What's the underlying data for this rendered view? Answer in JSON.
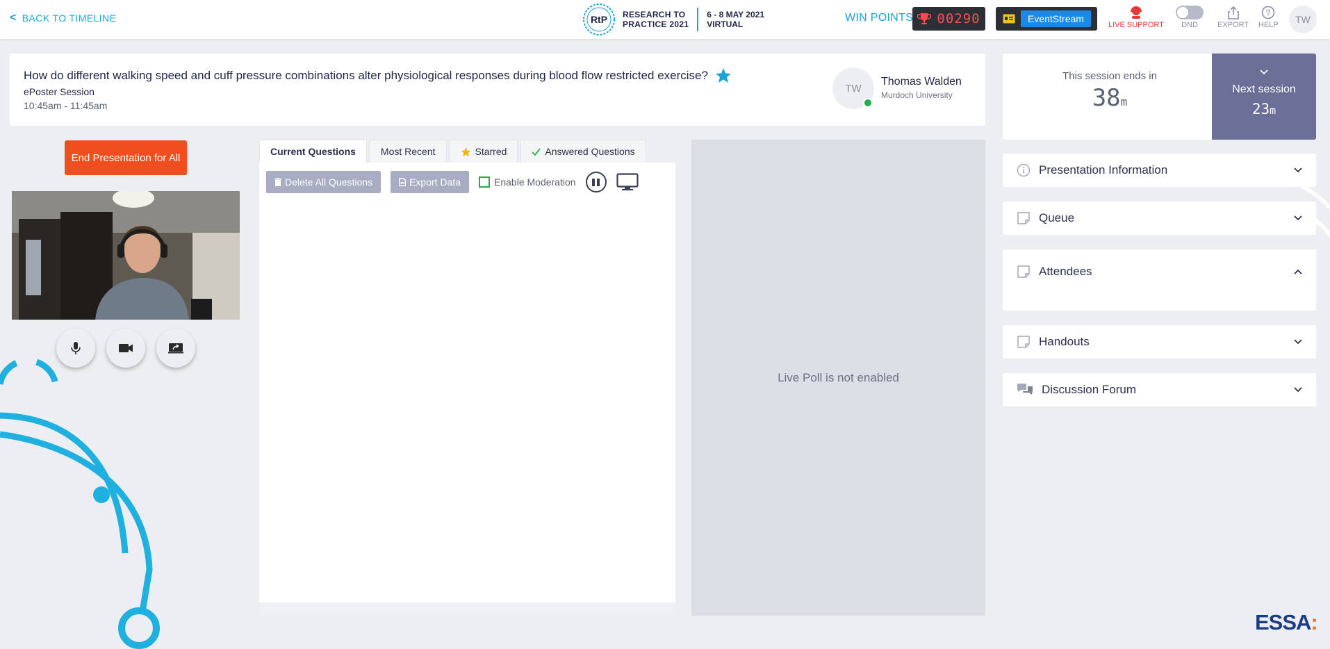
{
  "topbar": {
    "back_label": "BACK TO TIMELINE",
    "brand": {
      "logo_text": "RtP",
      "name_line1": "RESEARCH TO",
      "name_line2": "PRACTICE  2021",
      "date_line1": "6 - 8 MAY 2021",
      "date_line2": "VIRTUAL"
    },
    "win_points_label": "WIN POINTS",
    "points_value": "00290",
    "eventstream_label": "EventStream",
    "live_support_label": "LIVE SUPPORT",
    "dnd_label": "DND",
    "export_label": "EXPORT",
    "help_label": "HELP",
    "user_initials": "TW"
  },
  "session": {
    "title": "How do different walking speed and cuff pressure combinations alter physiological responses during blood flow restricted exercise?",
    "type": "ePoster Session",
    "time": "10:45am - 11:45am",
    "presenter": {
      "initials": "TW",
      "name": "Thomas Walden",
      "organization": "Murdoch University"
    }
  },
  "controls": {
    "end_presentation_label": "End Presentation for All",
    "media_buttons": [
      "microphone-icon",
      "camera-icon",
      "share-screen-icon"
    ]
  },
  "questions": {
    "tabs": [
      {
        "label": "Current Questions",
        "icon": ""
      },
      {
        "label": "Most Recent",
        "icon": ""
      },
      {
        "label": "Starred",
        "icon": "star-icon"
      },
      {
        "label": "Answered Questions",
        "icon": "check-icon"
      }
    ],
    "delete_label": "Delete All Questions",
    "export_label": "Export Data",
    "moderation_label": "Enable Moderation"
  },
  "poll": {
    "message": "Live Poll is not enabled"
  },
  "timer": {
    "label": "This session ends in",
    "value": "38",
    "unit": "m"
  },
  "next_session": {
    "label": "Next session",
    "value": "23",
    "unit": "m"
  },
  "accordions": [
    {
      "title": "Presentation Information",
      "icon": "info-icon",
      "expanded": false
    },
    {
      "title": "Queue",
      "icon": "note-icon",
      "expanded": false
    },
    {
      "title": "Attendees",
      "icon": "note-icon",
      "expanded": true
    },
    {
      "title": "Handouts",
      "icon": "note-icon",
      "expanded": false
    },
    {
      "title": "Discussion Forum",
      "icon": "chat-icon",
      "expanded": false
    }
  ],
  "footer": {
    "logo_text": "ESSA",
    "logo_accent": ":"
  },
  "colors": {
    "accent": "#1aa5d8",
    "end_button": "#f04e1e",
    "next_session_bg": "#6b6e96",
    "points_text": "#ff4d4d"
  }
}
